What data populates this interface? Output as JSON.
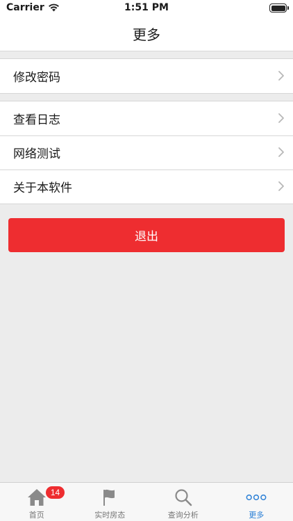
{
  "status_bar": {
    "carrier": "Carrier",
    "time": "1:51 PM"
  },
  "nav": {
    "title": "更多"
  },
  "menu_groups": [
    {
      "items": [
        {
          "label": "修改密码"
        }
      ]
    },
    {
      "items": [
        {
          "label": "查看日志"
        },
        {
          "label": "网络测试"
        },
        {
          "label": "关于本软件"
        }
      ]
    }
  ],
  "logout_label": "退出",
  "tabs": [
    {
      "label": "首页",
      "icon": "home-icon",
      "badge": "14",
      "active": false
    },
    {
      "label": "实时房态",
      "icon": "flag-icon",
      "active": false
    },
    {
      "label": "查询分析",
      "icon": "search-icon",
      "active": false
    },
    {
      "label": "更多",
      "icon": "more-dots-icon",
      "active": true
    }
  ],
  "colors": {
    "accent_red": "#ee2d30",
    "active_tab_blue": "#2a7fd6",
    "background": "#ececec"
  }
}
